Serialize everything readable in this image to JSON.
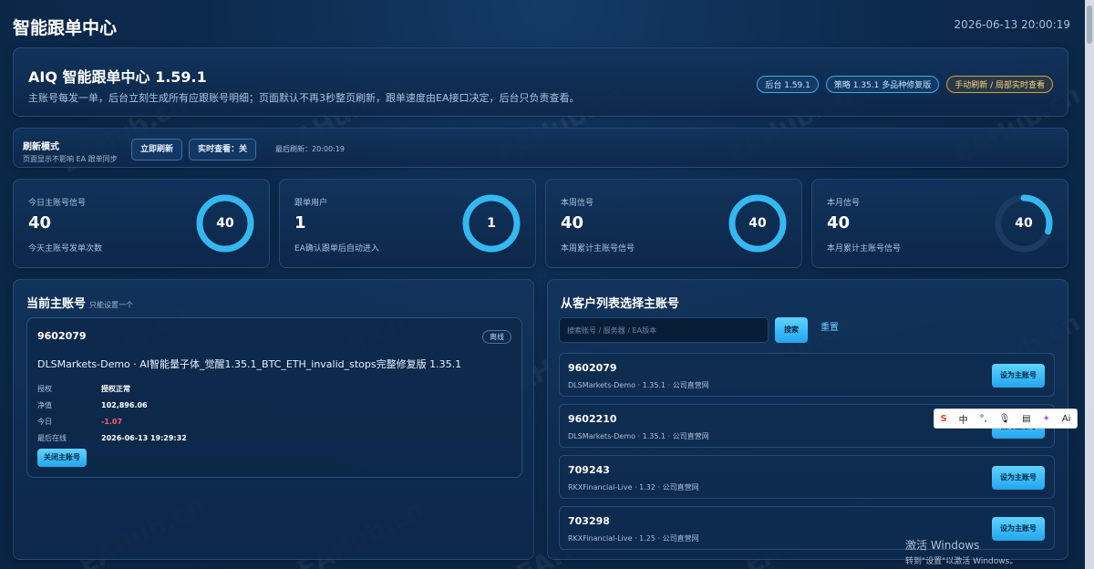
{
  "app": {
    "title": "智能跟单中心",
    "datetime": "2026-06-13 20:00:19"
  },
  "hero": {
    "title": "AIQ 智能跟单中心 1.59.1",
    "description": "主账号每发一单，后台立刻生成所有应跟账号明细；页面默认不再3秒整页刷新，跟单速度由EA接口决定，后台只负责查看。",
    "badges": [
      "后台 1.59.1",
      "策略 1.35.1 多品种修复版",
      "手动刷新 / 局部实时查看"
    ]
  },
  "refresh": {
    "title": "刷新模式",
    "subtitle": "页面显示不影响 EA 跟单同步",
    "refresh_now": "立即刷新",
    "realtime": "实时查看：关",
    "last_refresh": "最后刷新：20:00:19"
  },
  "stats": [
    {
      "label": "今日主账号信号",
      "value": "40",
      "note": "今天主账号发单次数",
      "ring": "40",
      "fill": 1.0
    },
    {
      "label": "跟单用户",
      "value": "1",
      "note": "EA确认跟单后自动进入",
      "ring": "1",
      "fill": 1.0
    },
    {
      "label": "本周信号",
      "value": "40",
      "note": "本周累计主账号信号",
      "ring": "40",
      "fill": 1.0
    },
    {
      "label": "本月信号",
      "value": "40",
      "note": "本月累计主账号信号",
      "ring": "40",
      "fill": 0.3
    }
  ],
  "current": {
    "title": "当前主账号",
    "hint": "只能设置一个",
    "account_id": "9602079",
    "status": "离线",
    "name": "DLSMarkets-Demo · AI智能量子体_觉醒1.35.1_BTC_ETH_invalid_stops完整修复版 1.35.1",
    "fields": [
      {
        "key": "授权",
        "value": "授权正常",
        "negative": false
      },
      {
        "key": "净值",
        "value": "102,896.06",
        "negative": false
      },
      {
        "key": "今日",
        "value": "-1.07",
        "negative": true
      },
      {
        "key": "最后在线",
        "value": "2026-06-13 19:29:32",
        "negative": false
      }
    ],
    "close_button": "关闭主账号"
  },
  "clients": {
    "title": "从客户列表选择主账号",
    "search_placeholder": "搜索账号 / 服务器 / EA版本",
    "search_button": "搜索",
    "reset_link": "重置",
    "set_button": "设为主账号",
    "rows": [
      {
        "id": "9602079",
        "meta": "DLSMarkets-Demo · 1.35.1 · 公司直营网"
      },
      {
        "id": "9602210",
        "meta": "DLSMarkets-Demo · 1.35.1 · 公司直营网"
      },
      {
        "id": "709243",
        "meta": "RKXFinancial-Live · 1.32 · 公司直营网"
      },
      {
        "id": "703298",
        "meta": "RKXFinancial-Live · 1.25 · 公司直营网"
      }
    ]
  },
  "ime": {
    "lang": "中",
    "ai": "Ai"
  },
  "activation": {
    "title": "激活 Windows",
    "subtitle": "转到\"设置\"以激活 Windows。"
  },
  "watermark": "EAHub.cn",
  "colors": {
    "accent": "#22a6ee",
    "negative": "#ff5d6c",
    "warning": "#ffd27a",
    "background": "#0c2a4d"
  }
}
